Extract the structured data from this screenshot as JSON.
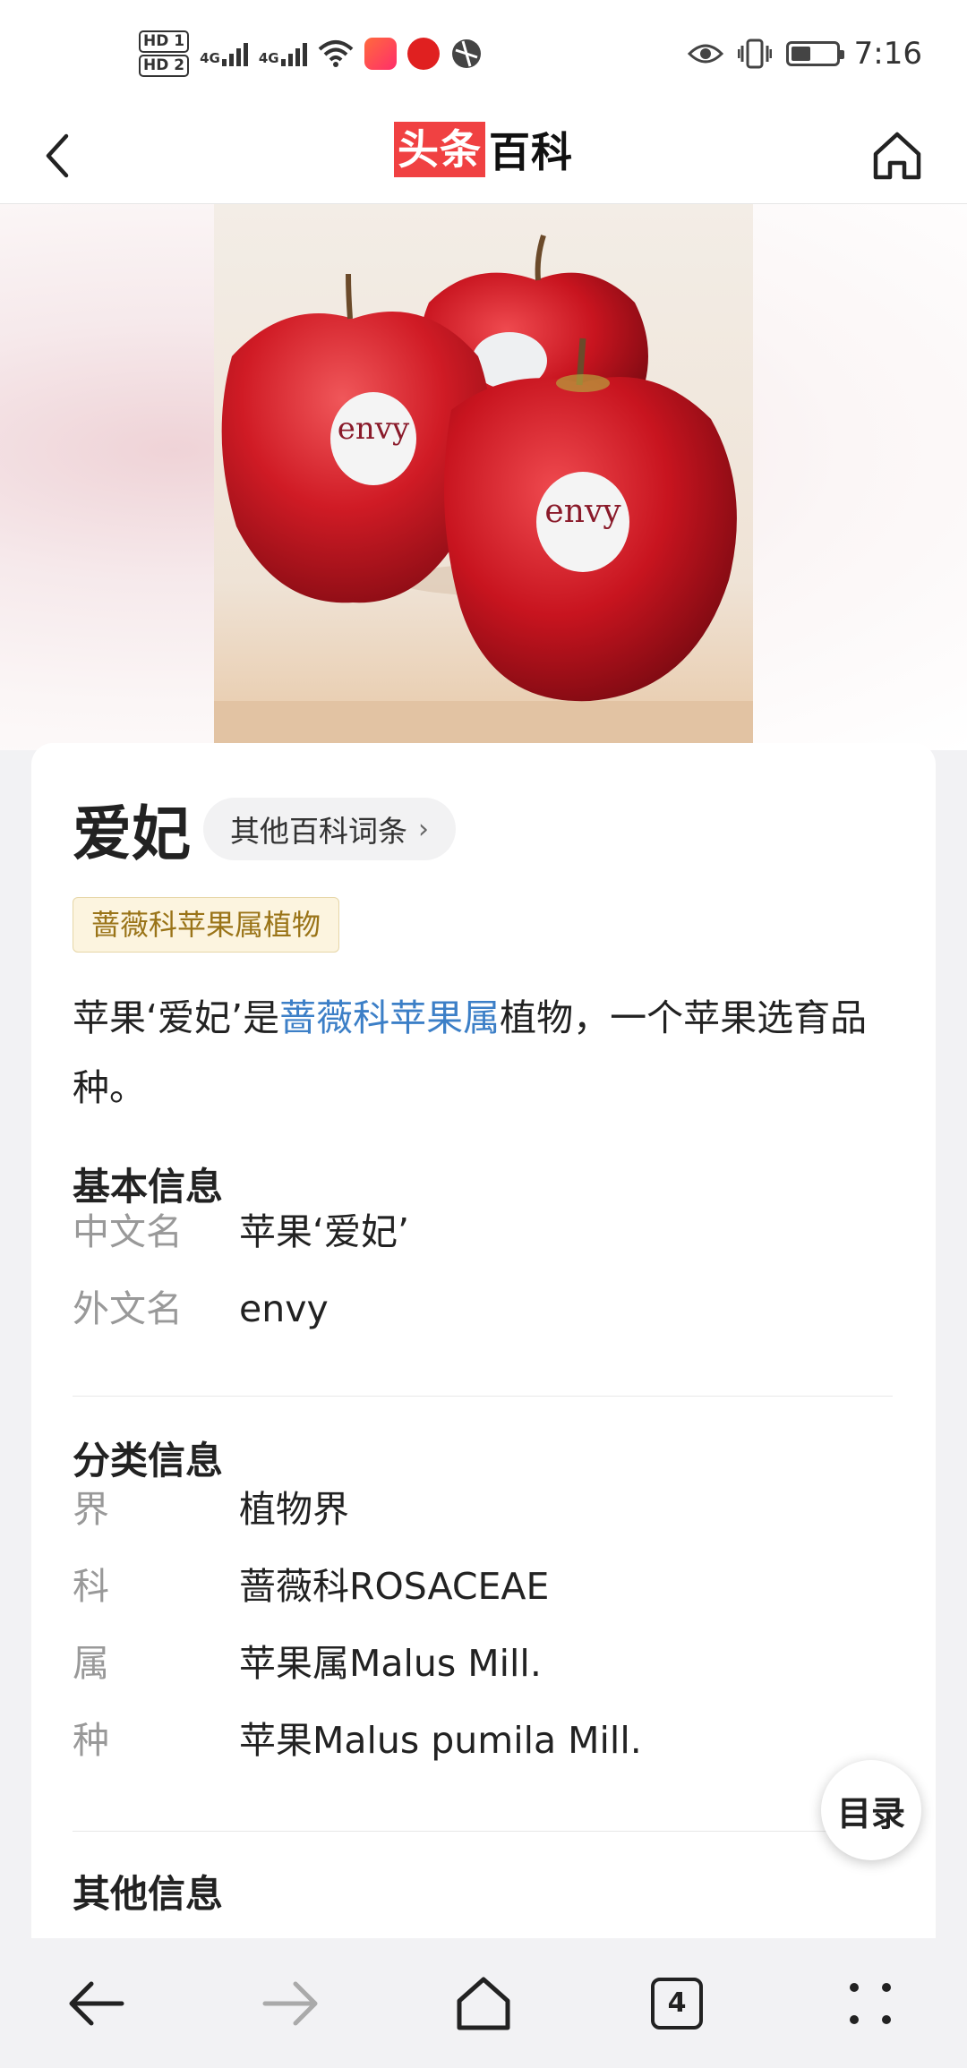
{
  "status_bar": {
    "hd1": "HD 1",
    "hd2": "HD 2",
    "net1": "4G",
    "net2": "4G",
    "time": "7:16"
  },
  "header": {
    "logo_red": "头条",
    "logo_black": "百科"
  },
  "hero": {
    "sticker_text": "envy"
  },
  "article": {
    "title": "爱妃",
    "other_entries_label": "其他百科词条",
    "category_tag": "蔷薇科苹果属植物",
    "summary_prefix": "苹果‘爱妃’是",
    "summary_link": "蔷薇科苹果属",
    "summary_suffix": "植物，一个苹果选育品种。"
  },
  "basic_info": {
    "title": "基本信息",
    "rows": [
      {
        "key": "中文名",
        "value": "苹果‘爱妃’"
      },
      {
        "key": "外文名",
        "value": "envy"
      }
    ]
  },
  "classification": {
    "title": "分类信息",
    "rows": [
      {
        "key": "界",
        "value": "植物界"
      },
      {
        "key": "科",
        "value": "蔷薇科ROSACEAE"
      },
      {
        "key": "属",
        "value": "苹果属Malus Mill."
      },
      {
        "key": "种",
        "value": "苹果Malus pumila Mill."
      }
    ]
  },
  "other_info": {
    "title": "其他信息"
  },
  "toc_button": "目录",
  "bottom_nav": {
    "tab_count": "4"
  }
}
